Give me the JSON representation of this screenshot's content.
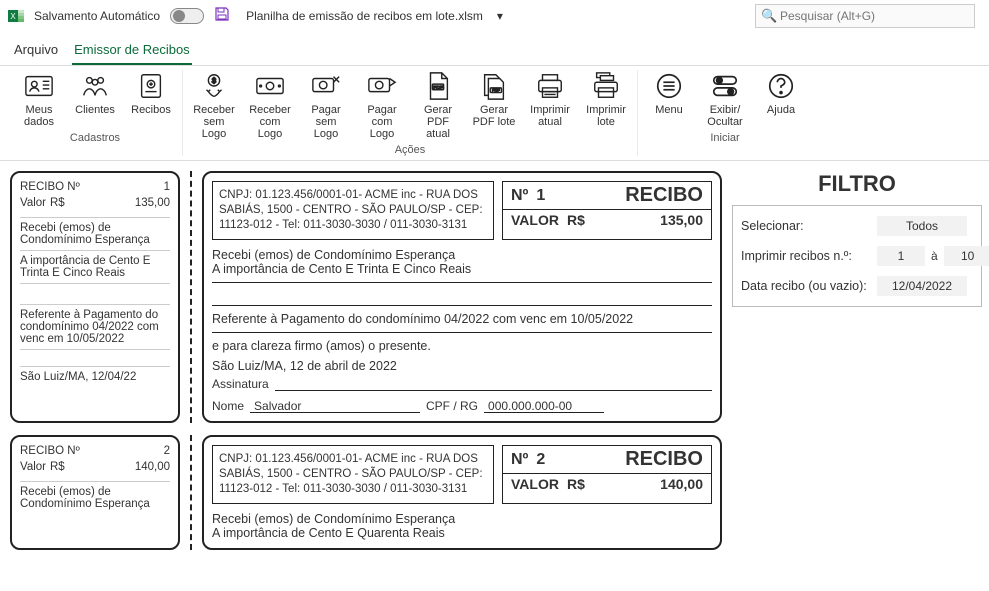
{
  "titlebar": {
    "autosave_label": "Salvamento Automático",
    "filename": "Planilha de emissão de recibos em lote.xlsm",
    "search_placeholder": "Pesquisar (Alt+G)"
  },
  "tabs": {
    "arquivo": "Arquivo",
    "emissor": "Emissor de Recibos"
  },
  "ribbon": {
    "groups": [
      {
        "label": "Cadastros",
        "items": [
          {
            "label": "Meus dados"
          },
          {
            "label": "Clientes"
          },
          {
            "label": "Recibos"
          }
        ]
      },
      {
        "label": "Ações",
        "items": [
          {
            "label": "Receber sem Logo"
          },
          {
            "label": "Receber com Logo"
          },
          {
            "label": "Pagar sem Logo"
          },
          {
            "label": "Pagar com Logo"
          },
          {
            "label": "Gerar PDF atual"
          },
          {
            "label": "Gerar PDF lote"
          },
          {
            "label": "Imprimir atual"
          },
          {
            "label": "Imprimir lote"
          }
        ]
      },
      {
        "label": "Iniciar",
        "items": [
          {
            "label": "Menu"
          },
          {
            "label": "Exibir/ Ocultar"
          },
          {
            "label": "Ajuda"
          }
        ]
      }
    ]
  },
  "receipts": [
    {
      "stub": {
        "recibo_label": "RECIBO Nº",
        "num": "1",
        "valor_label": "Valor",
        "moeda": "R$",
        "valor": "135,00",
        "recebi": "Recebi (emos) de Condomínimo Esperança",
        "importancia": "A importância de Cento E Trinta E Cinco Reais",
        "referente": "Referente à Pagamento do condomínimo 04/2022 com venc em 10/05/2022",
        "local_data": "São Luiz/MA, 12/04/22"
      },
      "big": {
        "company": "CNPJ: 01.123.456/0001-01- ACME inc - RUA DOS SABIÁS, 1500 - CENTRO - SÃO PAULO/SP - CEP: 11123-012 - Tel: 011-3030-3030 / 011-3030-3131",
        "num_label": "Nº",
        "num": "1",
        "recibo_word": "RECIBO",
        "valor_label": "VALOR",
        "moeda": "R$",
        "valor": "135,00",
        "l1": "Recebi (emos) de Condomínimo Esperança",
        "l2": "A importância de Cento E Trinta E Cinco Reais",
        "l3": "Referente à Pagamento do condomínimo 04/2022 com venc em 10/05/2022",
        "l4": "e para clareza firmo (amos) o presente.",
        "local_data": "São Luiz/MA, 12 de abril de 2022",
        "assinatura_label": "Assinatura",
        "nome_label": "Nome",
        "nome": "Salvador",
        "cpfrg_label": "CPF / RG",
        "cpfrg": "000.000.000-00"
      }
    },
    {
      "stub": {
        "recibo_label": "RECIBO Nº",
        "num": "2",
        "valor_label": "Valor",
        "moeda": "R$",
        "valor": "140,00",
        "recebi": "Recebi (emos) de Condomínimo Esperança",
        "importancia": "",
        "referente": "",
        "local_data": ""
      },
      "big": {
        "company": "CNPJ: 01.123.456/0001-01- ACME inc - RUA DOS SABIÁS, 1500 - CENTRO - SÃO PAULO/SP - CEP: 11123-012 - Tel: 011-3030-3030 / 011-3030-3131",
        "num_label": "Nº",
        "num": "2",
        "recibo_word": "RECIBO",
        "valor_label": "VALOR",
        "moeda": "R$",
        "valor": "140,00",
        "l1": "Recebi (emos) de Condomínimo Esperança",
        "l2": "A importância de Cento E Quarenta Reais",
        "l3": "",
        "l4": "",
        "local_data": "",
        "assinatura_label": "",
        "nome_label": "",
        "nome": "",
        "cpfrg_label": "",
        "cpfrg": ""
      }
    }
  ],
  "filter": {
    "title": "FILTRO",
    "selecionar_label": "Selecionar:",
    "selecionar_value": "Todos",
    "imprimir_label": "Imprimir recibos n.º:",
    "imprimir_from": "1",
    "imprimir_sep": "à",
    "imprimir_to": "10",
    "data_label": "Data recibo (ou vazio):",
    "data_value": "12/04/2022"
  }
}
